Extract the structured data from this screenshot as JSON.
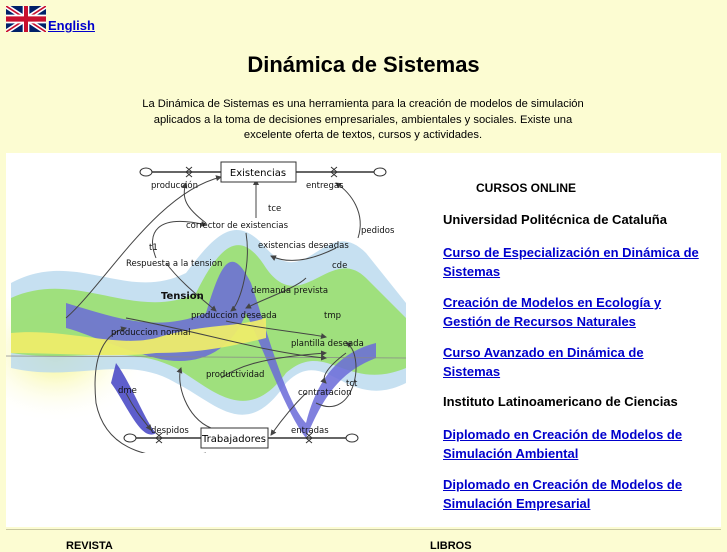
{
  "language": {
    "flag_icon": "uk-flag-icon",
    "label": "English"
  },
  "title": "Dinámica de Sistemas",
  "intro": "La Dinámica de Sistemas es una herramienta para la creación de modelos de simulación aplicados a la toma de decisiones empresariales, ambientales y sociales. Existe una excelente oferta de textos, cursos y actividades.",
  "diagram": {
    "labels": {
      "existencias": "Existencias",
      "produccion": "producción",
      "entregas": "entregas",
      "tce": "tce",
      "corrector": "corrector de existencias",
      "pedidos": "pedidos",
      "t1": "t1",
      "existencias_deseadas": "existencias deseadas",
      "respuesta": "Respuesta a la tension",
      "cde": "cde",
      "tension": "Tension",
      "demanda": "demanda prevista",
      "produccion_deseada": "produccion deseada",
      "tmp": "tmp",
      "produccion_normal": "produccion normal",
      "plantilla": "plantilla deseada",
      "productividad": "productividad",
      "tct": "tct",
      "dme": "dme",
      "contratacion": "contratacion",
      "despidos": "despidos",
      "trabajadores": "Trabajadores",
      "entradas": "entradas"
    }
  },
  "courses": {
    "title": "CURSOS ONLINE",
    "institutions": [
      {
        "name": "Universidad Politécnica de Cataluña",
        "courses": [
          "Curso de Especialización en Dinámica de Sistemas",
          "Creación de Modelos en Ecología y Gestión de Recursos Naturales",
          "Curso Avanzado en Dinámica de Sistemas "
        ]
      },
      {
        "name": "Instituto Latinoamericano de Ciencias",
        "courses": [
          "Diplomado en Creación de Modelos de Simulación Ambiental",
          "Diplomado en Creación de Modelos de Simulación Empresarial"
        ]
      }
    ]
  },
  "bottom": {
    "left": "REVISTA",
    "right": "LIBROS"
  }
}
